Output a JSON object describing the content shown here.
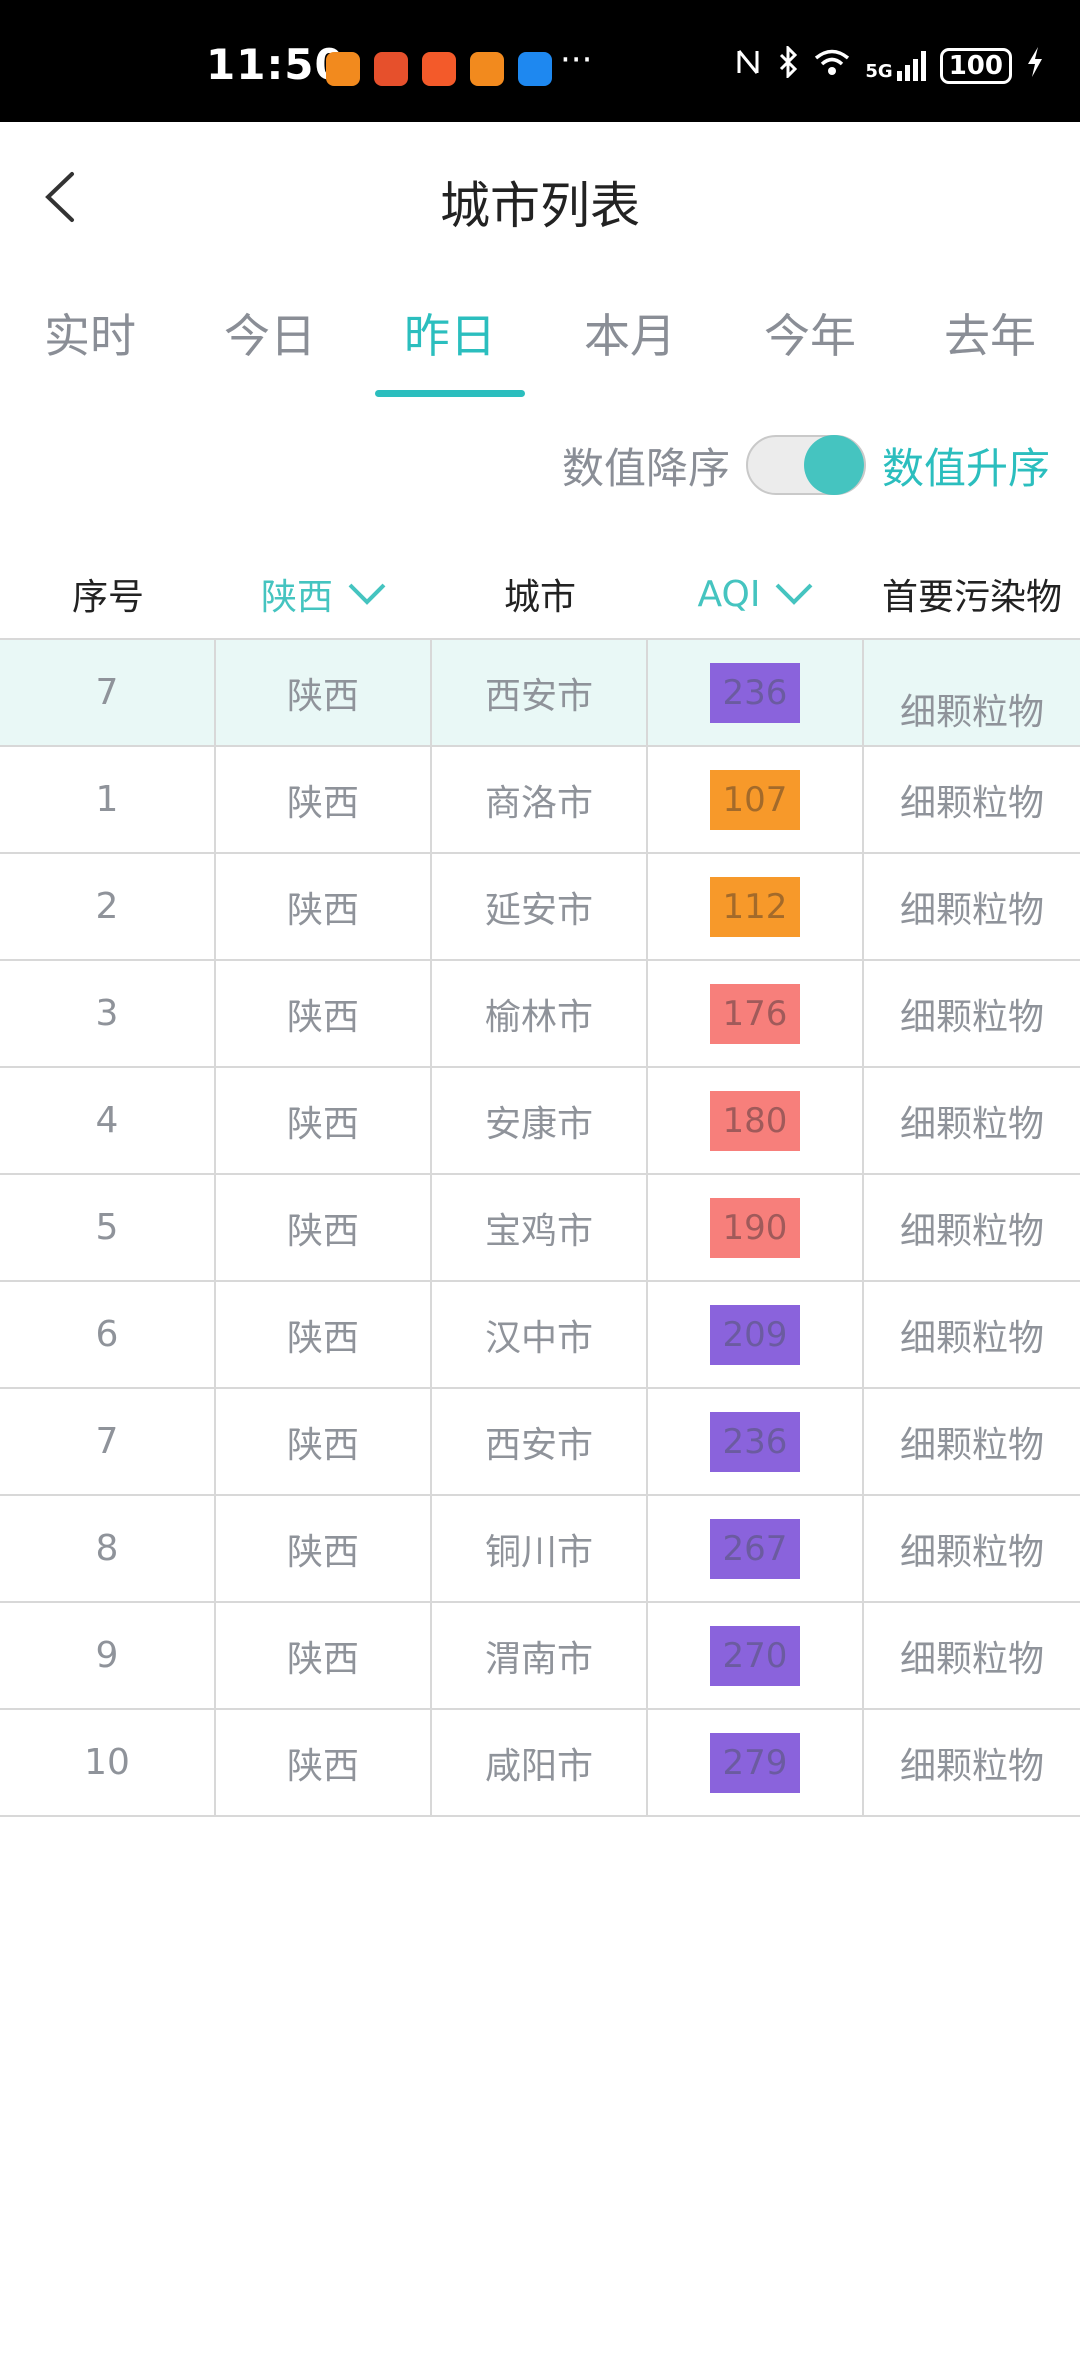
{
  "status_bar": {
    "time": "11:50",
    "more": "···",
    "network": "5G",
    "battery": "100",
    "apps": [
      {
        "icon": "taobao-icon",
        "color": "#f28a1e"
      },
      {
        "icon": "weibo-icon",
        "color": "#e6502c"
      },
      {
        "icon": "app-grid-icon",
        "color": "#f35a2a"
      },
      {
        "icon": "taobao-icon",
        "color": "#f28a1e"
      },
      {
        "icon": "message-icon",
        "color": "#1e88f0"
      }
    ]
  },
  "header": {
    "title": "城市列表",
    "back_icon": "chevron-left-icon"
  },
  "tabs": [
    {
      "label": "实时",
      "active": false
    },
    {
      "label": "今日",
      "active": false
    },
    {
      "label": "昨日",
      "active": true
    },
    {
      "label": "本月",
      "active": false
    },
    {
      "label": "今年",
      "active": false
    },
    {
      "label": "去年",
      "active": false
    }
  ],
  "sort": {
    "desc_label": "数值降序",
    "asc_label": "数值升序",
    "ascending": true
  },
  "table": {
    "headers": {
      "index": "序号",
      "province": "陕西",
      "city": "城市",
      "aqi": "AQI",
      "pollutant": "首要污染物"
    },
    "rows": [
      {
        "index": "7",
        "province": "陕西",
        "city": "西安市",
        "aqi": "236",
        "aqi_color": "#8a63dc",
        "pollutant": "细颗粒物",
        "highlight": true
      },
      {
        "index": "1",
        "province": "陕西",
        "city": "商洛市",
        "aqi": "107",
        "aqi_color": "#f7992a",
        "pollutant": "细颗粒物"
      },
      {
        "index": "2",
        "province": "陕西",
        "city": "延安市",
        "aqi": "112",
        "aqi_color": "#f7992a",
        "pollutant": "细颗粒物"
      },
      {
        "index": "3",
        "province": "陕西",
        "city": "榆林市",
        "aqi": "176",
        "aqi_color": "#f77f7b",
        "pollutant": "细颗粒物"
      },
      {
        "index": "4",
        "province": "陕西",
        "city": "安康市",
        "aqi": "180",
        "aqi_color": "#f77f7b",
        "pollutant": "细颗粒物"
      },
      {
        "index": "5",
        "province": "陕西",
        "city": "宝鸡市",
        "aqi": "190",
        "aqi_color": "#f77f7b",
        "pollutant": "细颗粒物"
      },
      {
        "index": "6",
        "province": "陕西",
        "city": "汉中市",
        "aqi": "209",
        "aqi_color": "#8a63dc",
        "pollutant": "细颗粒物"
      },
      {
        "index": "7",
        "province": "陕西",
        "city": "西安市",
        "aqi": "236",
        "aqi_color": "#8a63dc",
        "pollutant": "细颗粒物"
      },
      {
        "index": "8",
        "province": "陕西",
        "city": "铜川市",
        "aqi": "267",
        "aqi_color": "#8a63dc",
        "pollutant": "细颗粒物"
      },
      {
        "index": "9",
        "province": "陕西",
        "city": "渭南市",
        "aqi": "270",
        "aqi_color": "#8a63dc",
        "pollutant": "细颗粒物"
      },
      {
        "index": "10",
        "province": "陕西",
        "city": "咸阳市",
        "aqi": "279",
        "aqi_color": "#8a63dc",
        "pollutant": "细颗粒物"
      }
    ]
  }
}
